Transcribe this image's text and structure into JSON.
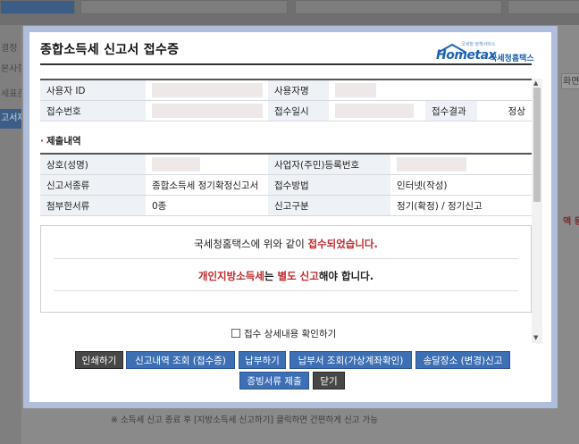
{
  "background": {
    "left_menu": [
      "결정",
      "본사항",
      "세표준",
      "고서제"
    ],
    "right_menu": [
      "화면",
      "액 등"
    ],
    "note": "※ 소득세 신고 종료 후 [지방소득세 신고하기] 클릭하면 간편하게 신고 가능"
  },
  "modal": {
    "title": "종합소득세 신고서 접수증",
    "logo": {
      "tagline": "국세청 정책서비스",
      "brand": "Hometax",
      "brand_kr": "국세청홈택스"
    },
    "basic_table": {
      "user_id_label": "사용자 ID",
      "user_name_label": "사용자명",
      "receipt_no_label": "접수번호",
      "receipt_date_label": "접수일시",
      "result_label": "접수결과",
      "result_value": "정상"
    },
    "section_title": "제출내역",
    "submit_table": {
      "company_label": "상호(성명)",
      "biz_no_label": "사업자(주민)등록번호",
      "form_type_label": "신고서종류",
      "form_type_value": "종합소득세 정기확정신고서",
      "method_label": "접수방법",
      "method_value": "인터넷(작성)",
      "attach_label": "첨부한서류",
      "attach_value": "0종",
      "category_label": "신고구분",
      "category_value": "정기(확정) / 정기신고"
    },
    "message": {
      "line1_prefix": "국세청홈택스에 위와 같이 ",
      "line1_highlight": "접수되었습니다.",
      "line2_part1": "개인지방소득세",
      "line2_part2": "는 ",
      "line2_part3": "별도 신고",
      "line2_part4": "해야 합니다."
    },
    "confirm_label": "접수 상세내용 확인하기",
    "buttons": {
      "print": "인쇄하기",
      "history": "신고내역 조회 (접수증)",
      "pay": "납부하기",
      "pay_inquiry": "납부서 조회(가상계좌확인)",
      "address": "송달장소 (변경)신고",
      "evidence": "증빙서류 제출",
      "close": "닫기"
    }
  }
}
